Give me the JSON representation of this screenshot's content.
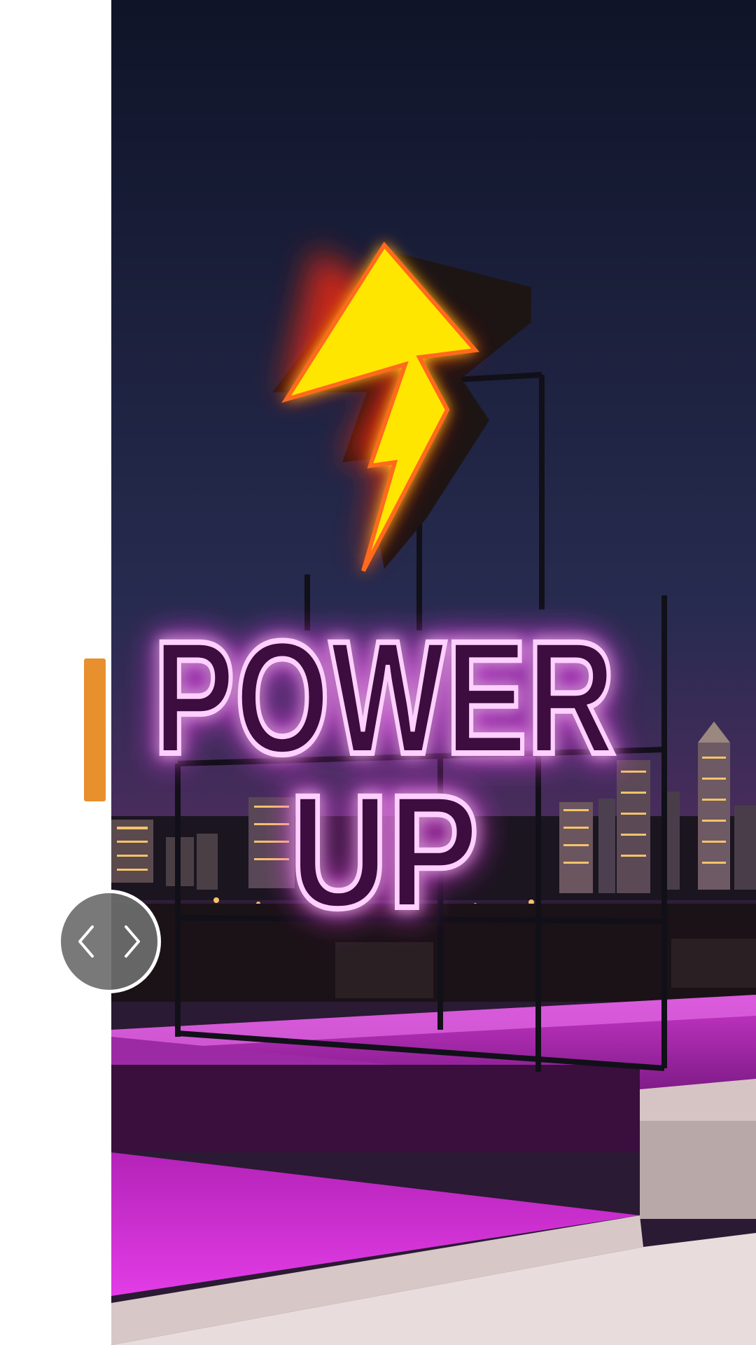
{
  "sign": {
    "line1": "POWER",
    "line2": "UP"
  },
  "colors": {
    "accent_orange": "#e8902e",
    "neon_magenta": "#ff3cff",
    "neon_yellow": "#ffe600",
    "sky_top": "#12172e",
    "sky_bottom": "#4a2a5e"
  },
  "icons": {
    "handle_left": "chevron-left-icon",
    "handle_right": "chevron-right-icon",
    "sign_symbol": "lightning-bolt-icon"
  }
}
